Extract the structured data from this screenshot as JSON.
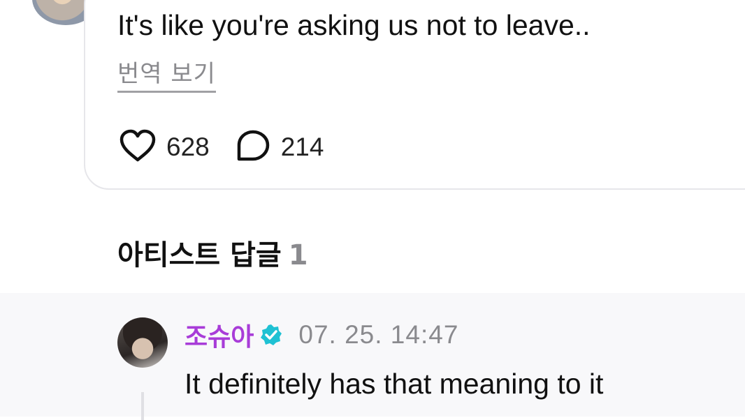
{
  "comment": {
    "text": "It's like you're asking us not to leave..",
    "translate_label": "번역 보기",
    "likes": "628",
    "replies": "214"
  },
  "artist_replies": {
    "title": "아티스트 답글",
    "count": "1"
  },
  "reply": {
    "author": "조슈아",
    "timestamp": "07. 25. 14:47",
    "text": "It definitely has that meaning to it"
  },
  "icons": {
    "like": "heart-outline-icon",
    "reply": "speech-bubble-icon",
    "verified": "verified-badge-icon"
  },
  "colors": {
    "artist_name": "#a83cd8",
    "verified_badge": "#1fc1d3",
    "muted_text": "#8a8a8e"
  }
}
